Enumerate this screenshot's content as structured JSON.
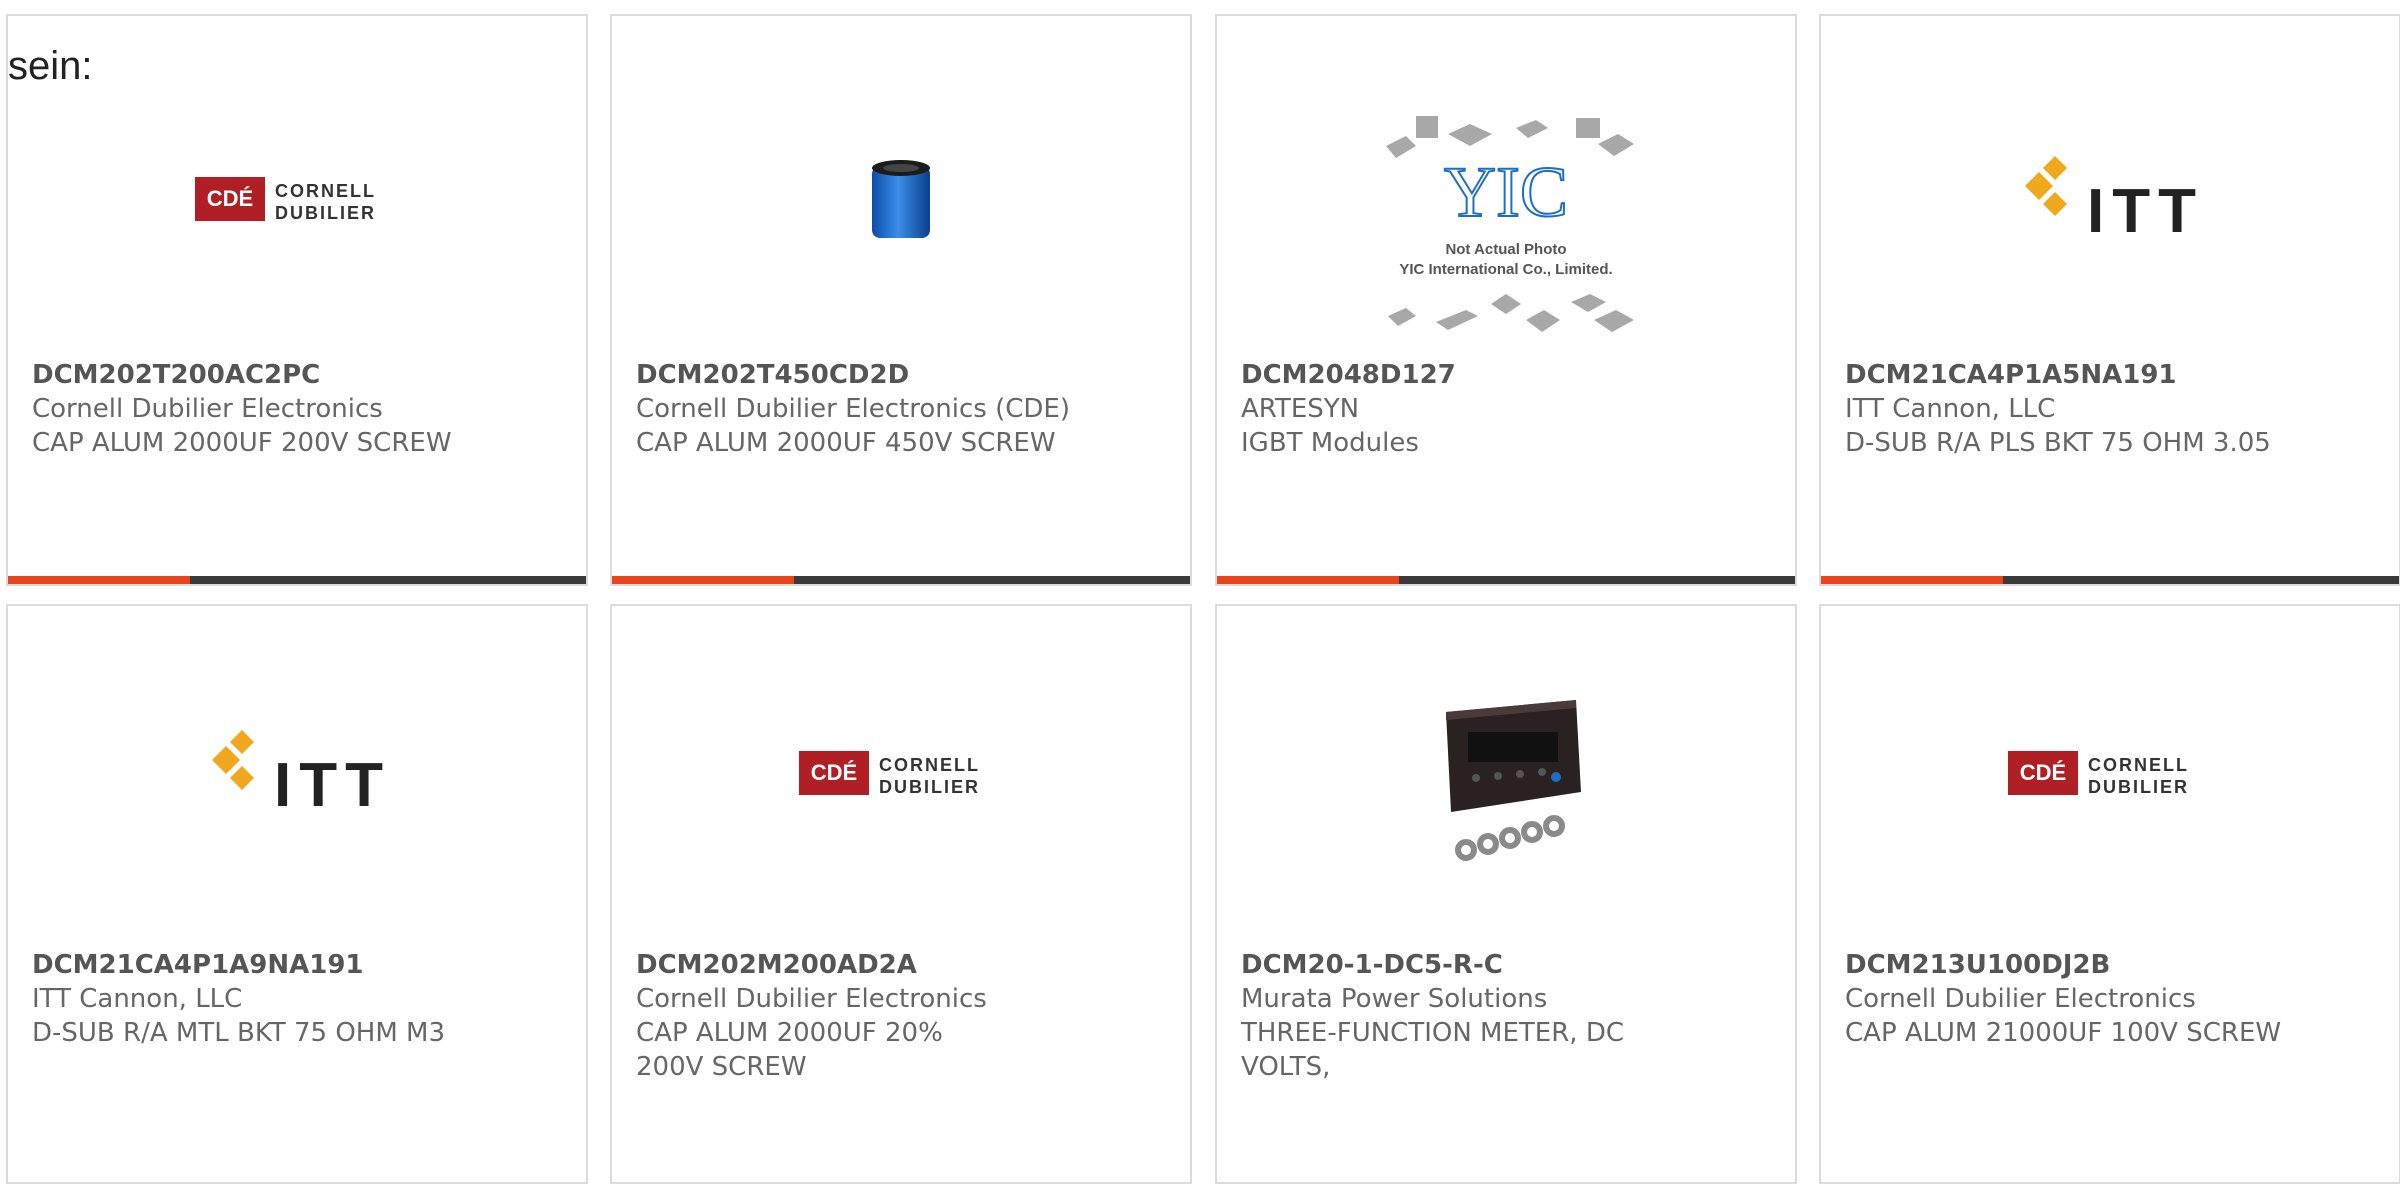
{
  "overlay_text": "sein:",
  "colors": {
    "accent": "#e8451a",
    "bar_dark": "#3a3a3a",
    "border": "#dcdcdc"
  },
  "products": [
    {
      "part": "DCM202T200AC2PC",
      "manufacturer": "Cornell Dubilier Electronics",
      "description": "CAP ALUM 2000UF 200V SCREW",
      "logo_top": "CORNELL",
      "logo_bottom": "DUBILIER",
      "logo_badge": "CDÉ",
      "image": "cde-logo"
    },
    {
      "part": "DCM202T450CD2D",
      "manufacturer": "Cornell Dubilier Electronics (CDE)",
      "description": "CAP ALUM 2000UF 450V SCREW",
      "image": "capacitor-image"
    },
    {
      "part": "DCM2048D127",
      "manufacturer": "ARTESYN",
      "description": "IGBT Modules",
      "logo_text": "YIC",
      "photo_note_1": "Not Actual Photo",
      "photo_note_2": "YIC International Co., Limited.",
      "image": "placeholder-photo"
    },
    {
      "part": "DCM21CA4P1A5NA191",
      "manufacturer": "ITT Cannon, LLC",
      "description": "D-SUB R/A PLS BKT 75 OHM 3.05",
      "logo_text": "ITT",
      "image": "itt-logo"
    },
    {
      "part": "DCM21CA4P1A9NA191",
      "manufacturer": "ITT Cannon, LLC",
      "description": "D-SUB R/A MTL BKT 75 OHM M3",
      "logo_text": "ITT",
      "image": "itt-logo"
    },
    {
      "part": "DCM202M200AD2A",
      "manufacturer": "Cornell Dubilier Electronics",
      "description": "CAP ALUM 2000UF 20% 200V SCREW",
      "logo_top": "CORNELL",
      "logo_bottom": "DUBILIER",
      "logo_badge": "CDÉ",
      "image": "cde-logo"
    },
    {
      "part": "DCM20-1-DC5-R-C",
      "manufacturer": "Murata Power Solutions",
      "description": "THREE-FUNCTION METER, DC VOLTS,",
      "image": "meter-image"
    },
    {
      "part": "DCM213U100DJ2B",
      "manufacturer": "Cornell Dubilier Electronics",
      "description": "CAP ALUM 21000UF 100V SCREW",
      "logo_top": "CORNELL",
      "logo_bottom": "DUBILIER",
      "logo_badge": "CDÉ",
      "image": "cde-logo"
    }
  ]
}
